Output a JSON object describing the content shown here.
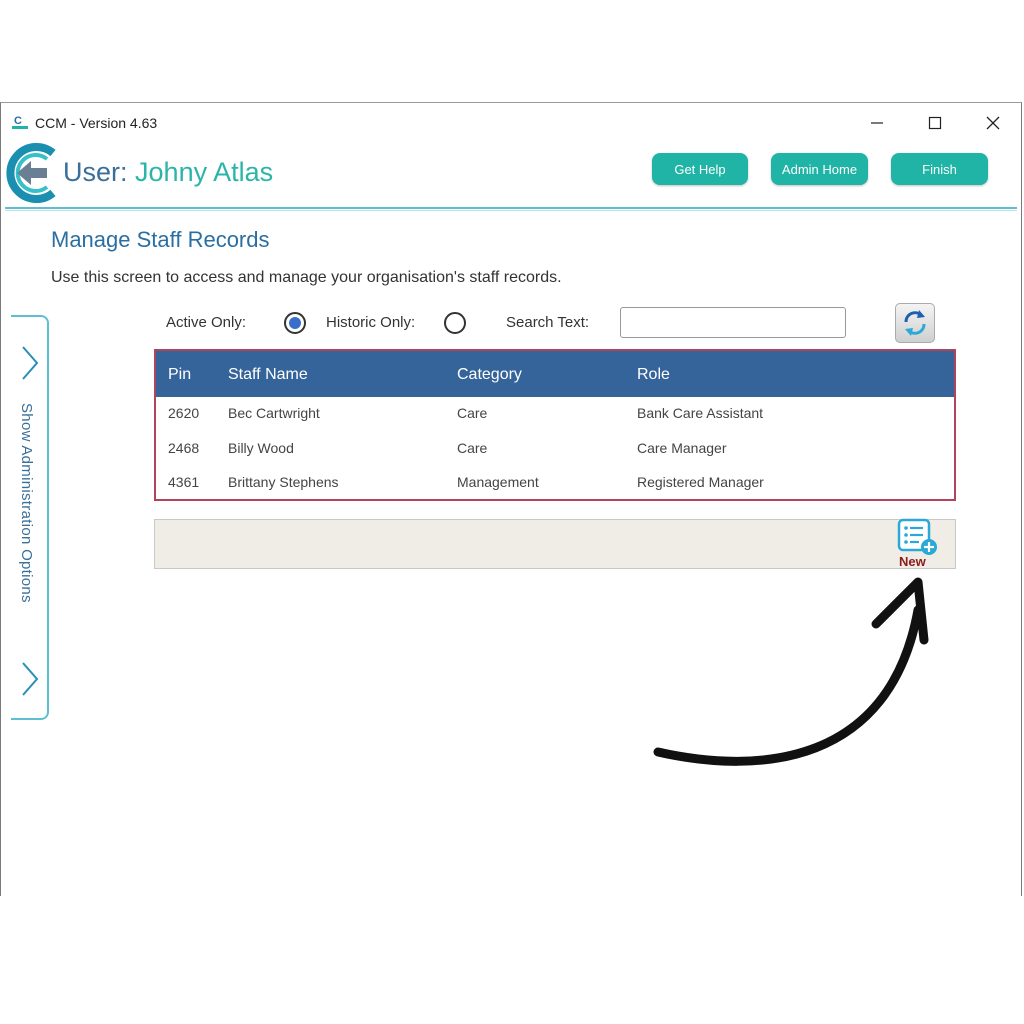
{
  "window": {
    "title": "CCM - Version 4.63"
  },
  "header": {
    "user_label": "User:",
    "user_name": "Johny Atlas",
    "buttons": {
      "help": "Get Help",
      "admin": "Admin Home",
      "finish": "Finish"
    }
  },
  "page": {
    "title": "Manage Staff Records",
    "description": "Use this screen to access and manage your organisation's staff records."
  },
  "sidebar": {
    "label": "Show Administration Options"
  },
  "filters": {
    "active_label": "Active Only:",
    "active_selected": true,
    "historic_label": "Historic Only:",
    "historic_selected": false,
    "search_label": "Search Text:",
    "search_value": ""
  },
  "table": {
    "columns": [
      "Pin",
      "Staff Name",
      "Category",
      "Role"
    ],
    "rows": [
      {
        "pin": "2620",
        "name": "Bec Cartwright",
        "category": "Care",
        "role": "Bank Care Assistant"
      },
      {
        "pin": "2468",
        "name": "Billy Wood",
        "category": "Care",
        "role": "Care Manager"
      },
      {
        "pin": "4361",
        "name": "Brittany Stephens",
        "category": "Management",
        "role": "Registered Manager"
      }
    ]
  },
  "toolbar": {
    "new_label": "New"
  },
  "colors": {
    "accent": "#1fb4a6",
    "header_bg": "#35649a",
    "title": "#2a6fa2",
    "grid_border": "#b0445c"
  },
  "icons": [
    "app-logo-icon",
    "back-arrow-icon",
    "minimize-icon",
    "maximize-icon",
    "close-icon",
    "chevron-right-icon",
    "refresh-icon",
    "new-record-icon",
    "curved-arrow-icon"
  ]
}
